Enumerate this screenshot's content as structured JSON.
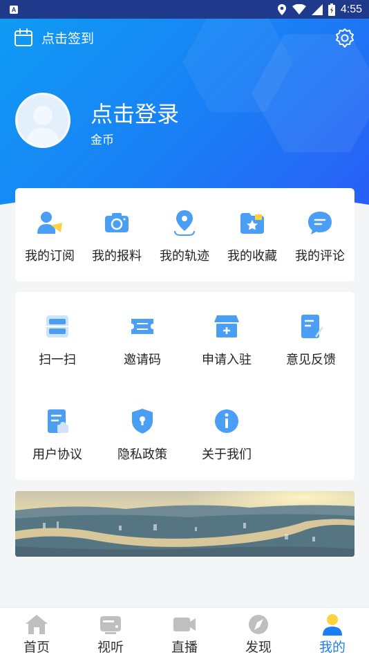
{
  "status_bar": {
    "time": "4:55",
    "badge": "A"
  },
  "header": {
    "checkin_label": "点击签到"
  },
  "profile": {
    "login_label": "点击登录",
    "coins_label": "金币"
  },
  "quick_menu": [
    {
      "label": "我的订阅",
      "icon": "subscribe-icon"
    },
    {
      "label": "我的报料",
      "icon": "camera-icon"
    },
    {
      "label": "我的轨迹",
      "icon": "location-icon"
    },
    {
      "label": "我的收藏",
      "icon": "favorite-icon"
    },
    {
      "label": "我的评论",
      "icon": "comment-icon"
    }
  ],
  "tools": [
    {
      "label": "扫一扫",
      "icon": "scan-icon"
    },
    {
      "label": "邀请码",
      "icon": "ticket-icon"
    },
    {
      "label": "申请入驻",
      "icon": "store-icon"
    },
    {
      "label": "意见反馈",
      "icon": "feedback-icon"
    },
    {
      "label": "用户协议",
      "icon": "agreement-icon"
    },
    {
      "label": "隐私政策",
      "icon": "shield-icon"
    },
    {
      "label": "关于我们",
      "icon": "info-icon"
    }
  ],
  "bottom_nav": [
    {
      "label": "首页",
      "icon": "home-icon"
    },
    {
      "label": "视听",
      "icon": "tv-icon"
    },
    {
      "label": "直播",
      "icon": "video-icon"
    },
    {
      "label": "发现",
      "icon": "compass-icon"
    },
    {
      "label": "我的",
      "icon": "user-icon",
      "active": true
    }
  ],
  "colors": {
    "accent": "#1a7ff5",
    "icon_blue": "#4a9ff5",
    "icon_yellow": "#ffd23f"
  }
}
